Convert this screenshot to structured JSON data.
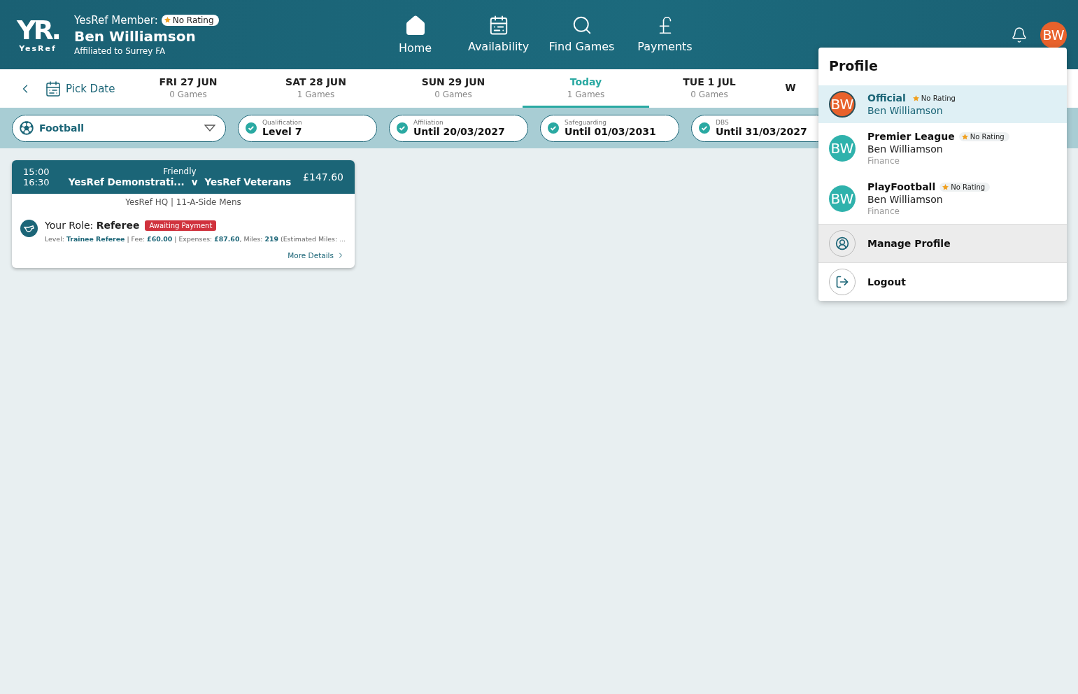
{
  "header": {
    "logo": {
      "mark": "YR.",
      "wordmark": "YesRef"
    },
    "member_label": "YesRef Member:",
    "rating": "No Rating",
    "name": "Ben Williamson",
    "affiliation": "Affiliated to Surrey FA",
    "avatar": "BW"
  },
  "nav": [
    {
      "label": "Home",
      "kind": "home"
    },
    {
      "label": "Availability",
      "kind": "calendar"
    },
    {
      "label": "Find Games",
      "kind": "search"
    },
    {
      "label": "Payments",
      "kind": "pound"
    }
  ],
  "date_bar": {
    "pick_date": "Pick Date",
    "dates": [
      {
        "day": "FRI 27 JUN",
        "games": "0 Games",
        "selected": false
      },
      {
        "day": "SAT 28 JUN",
        "games": "1 Games",
        "selected": false
      },
      {
        "day": "SUN 29 JUN",
        "games": "0 Games",
        "selected": false
      },
      {
        "day": "Today",
        "games": "1 Games",
        "selected": true
      },
      {
        "day": "TUE 1 JUL",
        "games": "0 Games",
        "selected": false
      },
      {
        "day": "W",
        "selected": false
      }
    ]
  },
  "filters": {
    "sport": "Football",
    "badges": [
      {
        "label": "Qualification",
        "value": "Level 7",
        "checked": true
      },
      {
        "label": "Affiliation",
        "value": "Until 20/03/2027",
        "checked": true
      },
      {
        "label": "Safeguarding",
        "value": "Until 01/03/2031",
        "checked": true
      },
      {
        "label": "DBS",
        "value": "Until 31/03/2027",
        "checked": true
      }
    ]
  },
  "match_card": {
    "start": "15:00",
    "end": "16:30",
    "competition": "Friendly",
    "home": "YesRef Demonstrati...",
    "versus": "v",
    "away": "YesRef Veterans",
    "total": "£147.60",
    "venue": "YesRef HQ | 11-A-Side Mens",
    "role": "Your Role: **Referee**",
    "status": "Awaiting Payment",
    "details": "Level: **Trainee Referee** |  Fee: **£60.00** | Expenses: **£87.60**, Miles: **219** (Estimated Miles: ...",
    "more": "More Details"
  },
  "profile_menu": {
    "title": "Profile",
    "profiles": [
      {
        "org": "Official",
        "rating": "No Rating",
        "name": "Ben Williamson",
        "avatar": "BW",
        "color": "#e8622c",
        "selected": true
      },
      {
        "org": "Premier League",
        "rating": "No Rating",
        "name": "Ben Williamson",
        "role": "Finance",
        "avatar": "BW",
        "color": "#2fb2ac",
        "selected": false
      },
      {
        "org": "PlayFootball",
        "rating": "No Rating",
        "name": "Ben Williamson",
        "role": "Finance",
        "avatar": "BW",
        "color": "#2fb2ac",
        "selected": false
      }
    ],
    "actions": [
      {
        "label": "Manage Profile",
        "kind": "profile",
        "highlighted": true
      },
      {
        "label": "Logout",
        "kind": "logout",
        "highlighted": false
      }
    ]
  }
}
